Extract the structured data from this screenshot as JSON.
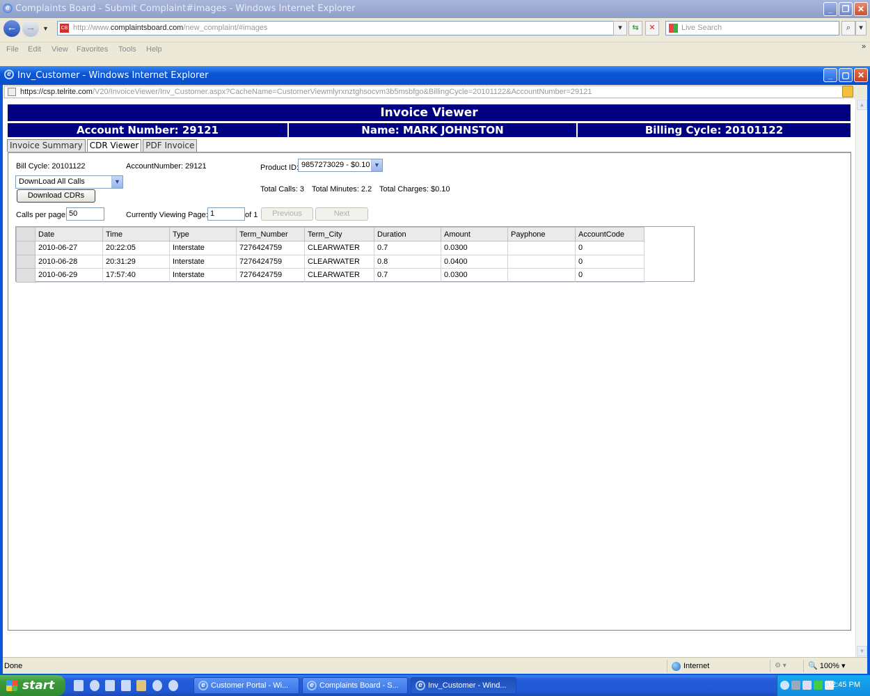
{
  "bg_window": {
    "title": "Complaints Board - Submit Complaint#images - Windows Internet Explorer",
    "address_prefix": "http://www.",
    "address_domain": "complaintsboard.com",
    "address_path": "/new_complaint/#images",
    "search_placeholder": "Live Search",
    "menu": [
      "File",
      "Edit",
      "View",
      "Favorites",
      "Tools",
      "Help"
    ]
  },
  "fg_window": {
    "title": "Inv_Customer - Windows Internet Explorer",
    "address_prefix": "https://csp.",
    "address_domain": "telrite.com",
    "address_path": "/V20/InvoiceViewer/Inv_Customer.aspx?CacheName=CustomerViewmlyrxnztghsocvm3b5msbfgo&BillingCycle=20101122&AccountNumber=29121",
    "status": "Done",
    "zone": "Internet",
    "zoom": "100%"
  },
  "header": {
    "title": "Invoice Viewer",
    "account": "Account Number: 29121",
    "name": "Name: MARK JOHNSTON",
    "billing": "Billing Cycle: 20101122"
  },
  "tabs": [
    "Invoice Summary",
    "CDR Viewer",
    "PDF Invoice"
  ],
  "cdr": {
    "bill_cycle": "Bill Cycle: 20101122",
    "account_number": "AccountNumber: 29121",
    "product_label": "Product ID:",
    "product_value": "9857273029 - $0.10",
    "download_select": "DownLoad All Calls",
    "download_button": "Download CDRs",
    "total_calls": "Total Calls: 3",
    "total_minutes": "Total Minutes: 2.2",
    "total_charges": "Total Charges: $0.10",
    "calls_per_page_label": "Calls per page:",
    "calls_per_page": "50",
    "viewing_label": "Currently Viewing Page:",
    "viewing_page": "1",
    "of_pages": "of 1",
    "prev_label": "Previous",
    "next_label": "Next",
    "columns": [
      "Date",
      "Time",
      "Type",
      "Term_Number",
      "Term_City",
      "Duration",
      "Amount",
      "Payphone",
      "AccountCode"
    ],
    "rows": [
      [
        "2010-06-27",
        "20:22:05",
        "Interstate",
        "7276424759",
        "CLEARWATER",
        "0.7",
        "0.0300",
        "",
        "0"
      ],
      [
        "2010-06-28",
        "20:31:29",
        "Interstate",
        "7276424759",
        "CLEARWATER",
        "0.8",
        "0.0400",
        "",
        "0"
      ],
      [
        "2010-06-29",
        "17:57:40",
        "Interstate",
        "7276424759",
        "CLEARWATER",
        "0.7",
        "0.0300",
        "",
        "0"
      ]
    ]
  },
  "taskbar": {
    "start": "start",
    "tasks": [
      "Customer Portal - Wi...",
      "Complaints Board - S...",
      "Inv_Customer - Wind..."
    ],
    "time": "12:45 PM"
  },
  "colors": {
    "banner": "#000080",
    "titlebar": "#0a56d6",
    "taskbar": "#245edb"
  }
}
